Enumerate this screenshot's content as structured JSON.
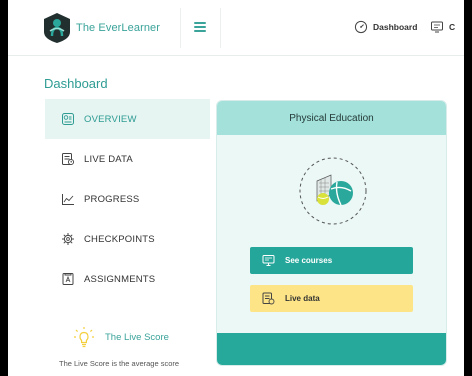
{
  "header": {
    "brand": "The EverLearner",
    "dashboard_link": "Dashboard",
    "cut_link": "C"
  },
  "page": {
    "title": "Dashboard"
  },
  "sidebar": {
    "items": [
      {
        "label": "OVERVIEW",
        "icon": "overview-icon",
        "active": true
      },
      {
        "label": "LIVE DATA",
        "icon": "live-data-icon",
        "active": false
      },
      {
        "label": "PROGRESS",
        "icon": "progress-chart-icon",
        "active": false
      },
      {
        "label": "CHECKPOINTS",
        "icon": "gear-icon",
        "active": false
      },
      {
        "label": "ASSIGNMENTS",
        "icon": "assignment-icon",
        "active": false
      }
    ]
  },
  "live_score": {
    "title": "The Live Score",
    "text": "The Live Score is the average score"
  },
  "course_card": {
    "title": "Physical Education",
    "emblem_icon": "sports-balls-icon",
    "see_courses_label": "See courses",
    "live_data_label": "Live data"
  },
  "colors": {
    "accent": "#2e9c93",
    "card_header": "#a3e1da",
    "card_body": "#ebf8f6",
    "button_teal": "#25a69a",
    "button_yellow": "#fde587",
    "sidebar_active": "#e6f4f2"
  }
}
